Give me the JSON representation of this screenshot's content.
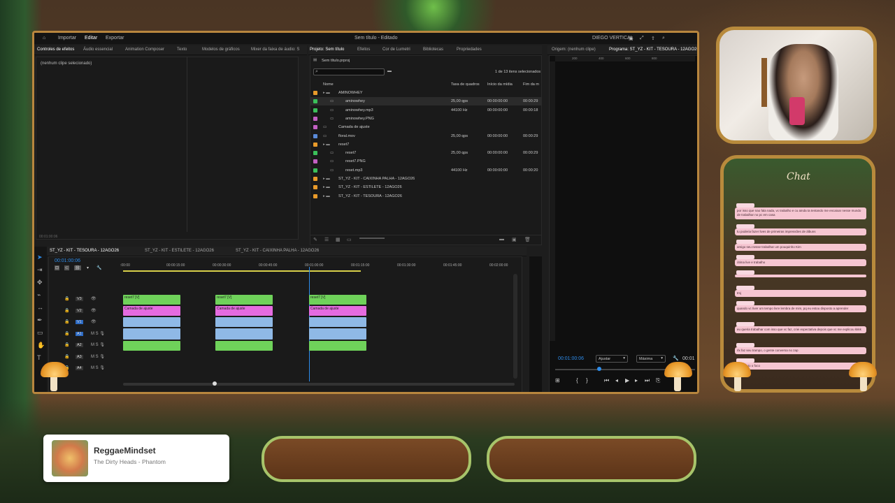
{
  "menu": {
    "import": "Importar",
    "edit": "Editar",
    "export": "Exportar",
    "title": "Sem título - Editado",
    "workspace": "DIEGO VERTICAL"
  },
  "left_tabs": [
    "Controles de efeitos",
    "Áudio essencial",
    "Animation Composer",
    "Texto",
    "Modelos de gráficos",
    "Mixer da faixa de áudio: S"
  ],
  "effect_controls": {
    "empty": "(nenhum clipe selecionado)",
    "time": "00:01:00:06"
  },
  "project_tabs": [
    "Projeto: Sem título",
    "Efeitos",
    "Cor de Lumetri",
    "Bibliotecas",
    "Propriedades"
  ],
  "project": {
    "file": "Sem título.prproj",
    "count": "1 de 13 itens selecionados",
    "headers": [
      "Nome",
      "Taxa de quadros",
      "Início da mídia",
      "Fim da m"
    ],
    "items": [
      {
        "name": "AMINOWHEY",
        "fps": "",
        "start": "",
        "end": "",
        "color": "#e89a2a",
        "folder": true,
        "indent": 0
      },
      {
        "name": "aminowhey",
        "fps": "25,00 qps",
        "start": "00:00:00:00",
        "end": "00:00:29",
        "color": "#3bbf5a",
        "indent": 1
      },
      {
        "name": "aminowhey.mp3",
        "fps": "44100 Hz",
        "start": "00:00:00:00",
        "end": "00:00:18",
        "color": "#3bbf5a",
        "indent": 1
      },
      {
        "name": "aminowhey.PNG",
        "fps": "",
        "start": "",
        "end": "",
        "color": "#c25fc2",
        "indent": 1
      },
      {
        "name": "Camada de ajuste",
        "fps": "",
        "start": "",
        "end": "",
        "color": "#c25fc2",
        "indent": 0
      },
      {
        "name": "floral.mov",
        "fps": "25,00 qps",
        "start": "00:00:00:00",
        "end": "00:00:29",
        "color": "#5a8ad8",
        "indent": 0
      },
      {
        "name": "reset7",
        "fps": "",
        "start": "",
        "end": "",
        "color": "#e89a2a",
        "folder": true,
        "indent": 0
      },
      {
        "name": "reset7",
        "fps": "25,00 qps",
        "start": "00:00:00:00",
        "end": "00:00:29",
        "color": "#3bbf5a",
        "indent": 1
      },
      {
        "name": "reset7.PNG",
        "fps": "",
        "start": "",
        "end": "",
        "color": "#c25fc2",
        "indent": 1
      },
      {
        "name": "reset.mp3",
        "fps": "44100 Hz",
        "start": "00:00:00:00",
        "end": "00:00:20",
        "color": "#3bbf5a",
        "indent": 1
      },
      {
        "name": "ST_YZ - KIT - CAIXINHA PALHA - 12AGO26",
        "fps": "",
        "start": "",
        "end": "",
        "color": "#e89a2a",
        "folder": true,
        "indent": 0
      },
      {
        "name": "ST_YZ - KIT - ESTILETE - 12AGO26",
        "fps": "",
        "start": "",
        "end": "",
        "color": "#e89a2a",
        "folder": true,
        "indent": 0
      },
      {
        "name": "ST_YZ - KIT - TESOURA - 12AGO26",
        "fps": "",
        "start": "",
        "end": "",
        "color": "#e89a2a",
        "folder": true,
        "indent": 0
      }
    ]
  },
  "monitor": {
    "source": "Origem: (nenhum clipe)",
    "program": "Programa: ST_YZ - KIT - TESOURA - 12AGO26",
    "time": "00:01:00:06",
    "fit": "Ajustar",
    "quality": "Máxima",
    "time_right": "00:01",
    "ruler": [
      "200",
      "400",
      "600",
      "800"
    ]
  },
  "timeline": {
    "tabs": [
      "ST_YZ - KIT - TESOURA - 12AGO26",
      "ST_YZ - KIT - ESTILETE - 12AGO26",
      "ST_YZ - KIT - CAIXINHA PALHA - 12AGO26"
    ],
    "time": "00:01:00:06",
    "ruler": [
      ":00:00",
      "00:00:15:00",
      "00:00:30:00",
      "00:00:45:00",
      "00:01:00:00",
      "00:01:15:00",
      "00:01:30:00",
      "00:01:45:00",
      "00:02:00:00"
    ],
    "tracks": [
      "V3",
      "V2",
      "V1",
      "A1",
      "A2",
      "A3",
      "A4"
    ],
    "clip_v3": "reset7 [V]",
    "clip_v2": "Camada de ajuste",
    "fx": "fx"
  },
  "chat": {
    "title": "Chat",
    "messages": [
      "por isso que nao fala nada, vc trabalho e cu ainda ta tentando me encaixar nesse mundo de trabalhar no pc em casa",
      "tu poderia fazer lives de primeiras impressões de álbuns",
      "amigo seu nesse trabalhar um pouquinho Kim",
      "ótima live e trabalho",
      "",
      "tmj",
      "quando vc tiver um tempo livre lembra de mim, pq eu estou disposto a aprender",
      "eu queria trabalhar com isso que vc faz, criei expectativa depois que vc me explicou kkkk",
      "rlx faz seu trampo, o gente conversa no zap",
      "sim ponto o foco"
    ]
  },
  "now_playing": {
    "title": "ReggaeMindset",
    "subtitle": "The Dirty Heads - Phantom"
  },
  "colors": {
    "frame": "#b8863e",
    "accent": "#2d8ceb",
    "clip_v": "#6fd25a",
    "clip_adj": "#e56be0",
    "clip_a": "#8fb9e6"
  }
}
